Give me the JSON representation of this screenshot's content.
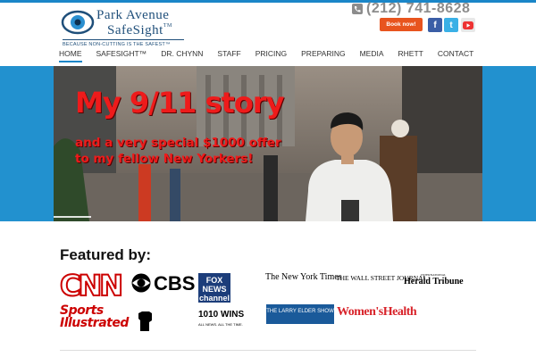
{
  "logo": {
    "line1": "Park Avenue",
    "line2": "SafeSight",
    "tm": "TM",
    "tagline": "BECAUSE NON-CUTTING IS THE SAFEST™"
  },
  "header": {
    "phone": "(212) 741-8628",
    "book_label": "Book now!",
    "social": {
      "facebook": "f",
      "twitter": "t"
    }
  },
  "nav": {
    "items": [
      {
        "label": "HOME"
      },
      {
        "label": "SAFESIGHT™"
      },
      {
        "label": "DR. CHYNN"
      },
      {
        "label": "STAFF"
      },
      {
        "label": "PRICING"
      },
      {
        "label": "PREPARING"
      },
      {
        "label": "MEDIA"
      },
      {
        "label": "RHETT"
      },
      {
        "label": "CONTACT"
      }
    ],
    "active": "HOME"
  },
  "hero": {
    "title": "My 9/11 story",
    "subtitle_line1": "and a very special $1000 offer",
    "subtitle_line2": "to my fellow New Yorkers!"
  },
  "featured": {
    "heading": "Featured by:",
    "outlets": {
      "cnn": "CNN",
      "cbs": "CBS",
      "fox": "FOX NEWS channel",
      "si": "Sports Illustrated",
      "wins": "1010 WINS",
      "wins_small": "ALL NEWS. ALL THE TIME.",
      "nyt": "The New York Times",
      "wsj": "THE WALL STREET JOURNAL",
      "iht": "Herald Tribune",
      "iht_small": "INTERNATIONAL",
      "elder": "THE LARRY ELDER SHOW",
      "wh": "Women'sHealth"
    }
  },
  "colors": {
    "accent": "#1a86c8",
    "hero_band": "#2291cf",
    "book_button": "#e8541e",
    "hero_text": "#ee1b1b",
    "logo": "#1f4f7a"
  }
}
